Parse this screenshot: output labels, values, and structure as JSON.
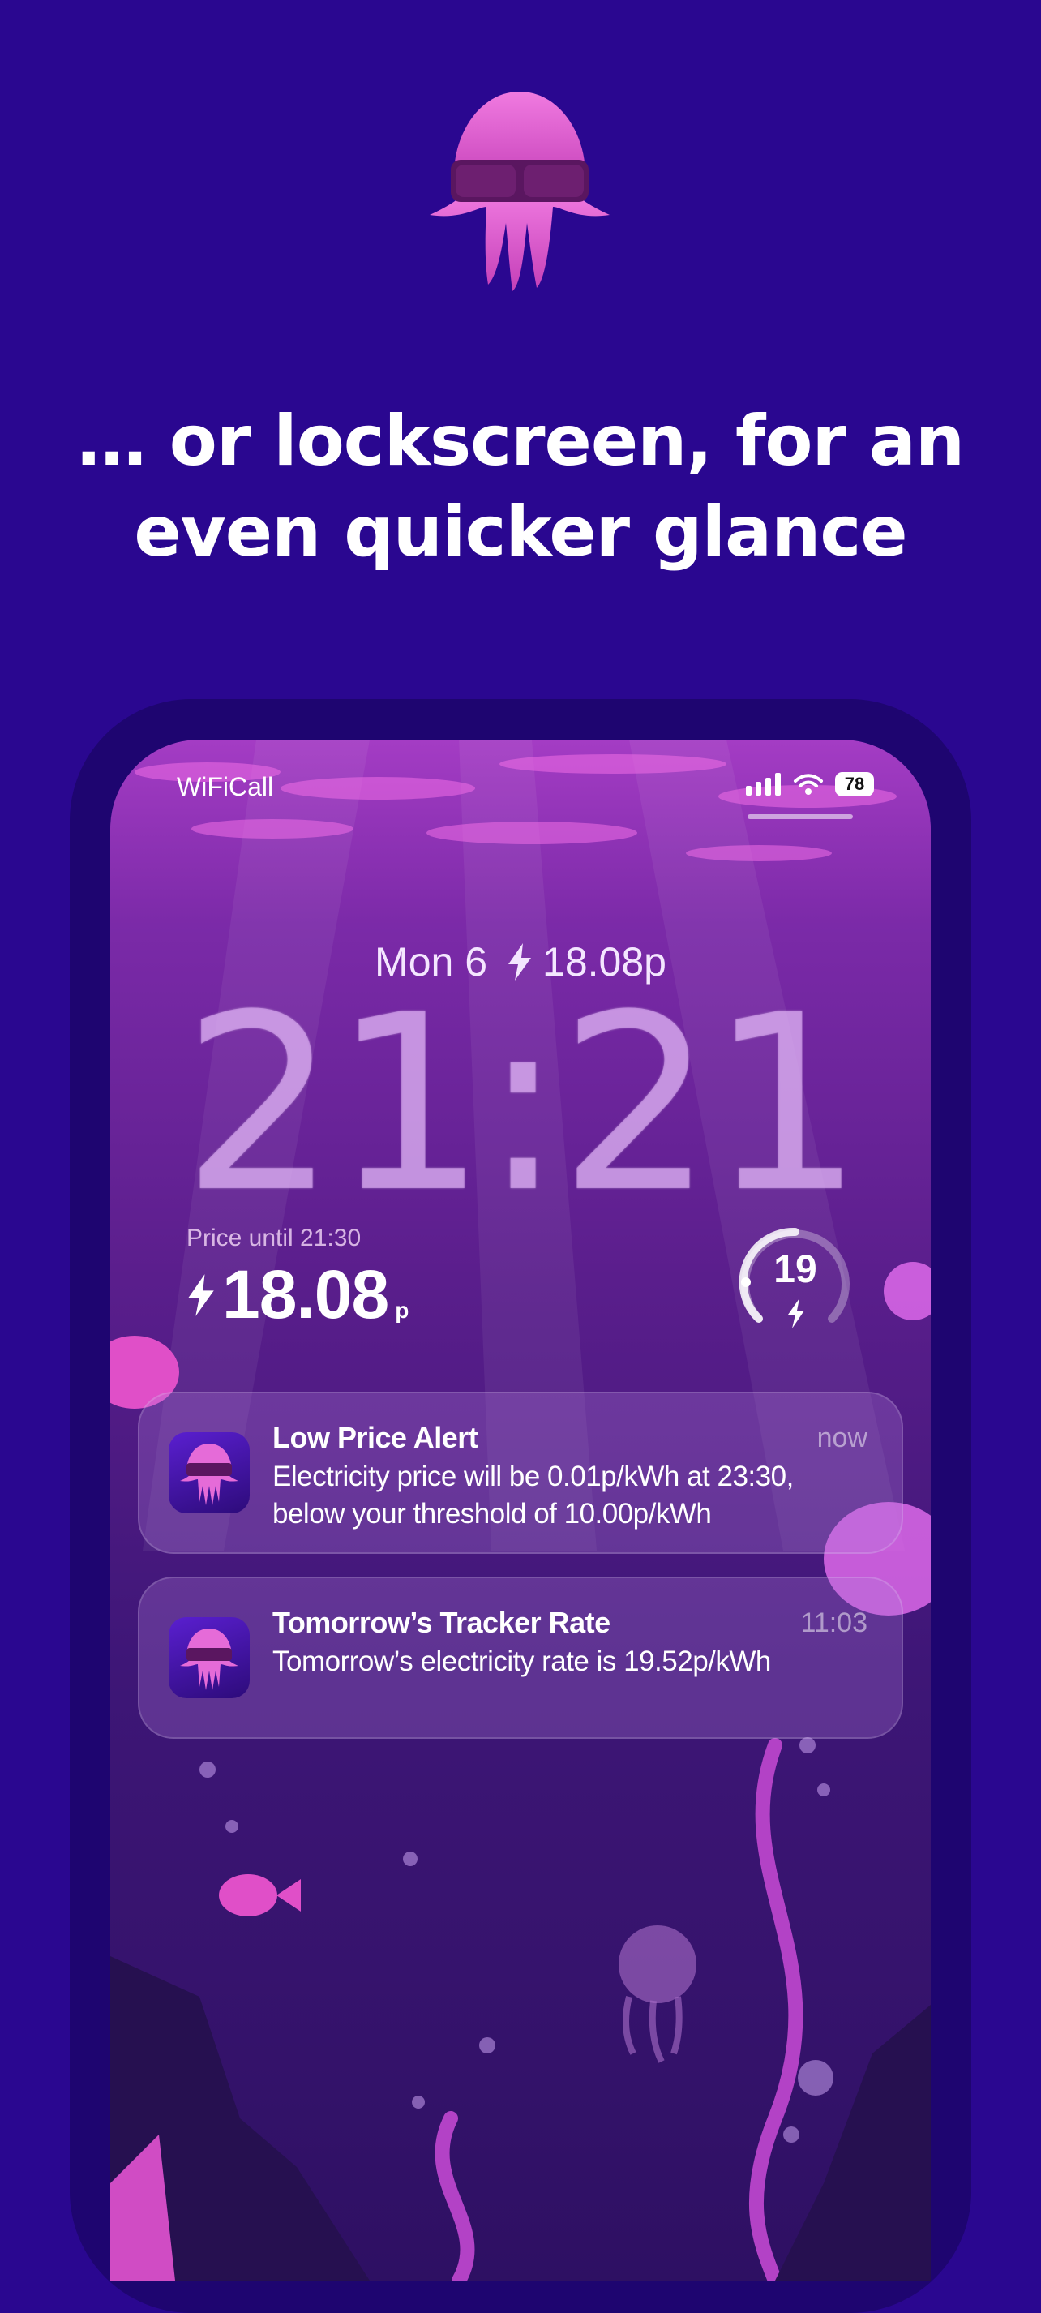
{
  "brand": {
    "logo_icon": "jellyfish-sunglasses-icon",
    "accent_color": "#2a0790"
  },
  "headline": {
    "line1": "… or lockscreen, for an",
    "line2": "even quicker glance"
  },
  "status_bar": {
    "carrier": "WiFiCall",
    "signal_icon": "signal-bars-icon",
    "wifi_icon": "wifi-icon",
    "battery": "78"
  },
  "lockscreen": {
    "date": "Mon 6",
    "date_price": "18.08p",
    "time": "21:21",
    "widget": {
      "caption": "Price until 21:30",
      "price": "18.08",
      "unit": "p",
      "gauge_value": "19"
    }
  },
  "notifications": [
    {
      "title": "Low Price Alert",
      "time": "now",
      "body": "Electricity price will be 0.01p/kWh at 23:30, below your threshold of 10.00p/kWh"
    },
    {
      "title": "Tomorrow’s Tracker Rate",
      "time": "11:03",
      "body": "Tomorrow’s electricity rate is 19.52p/kWh"
    }
  ]
}
